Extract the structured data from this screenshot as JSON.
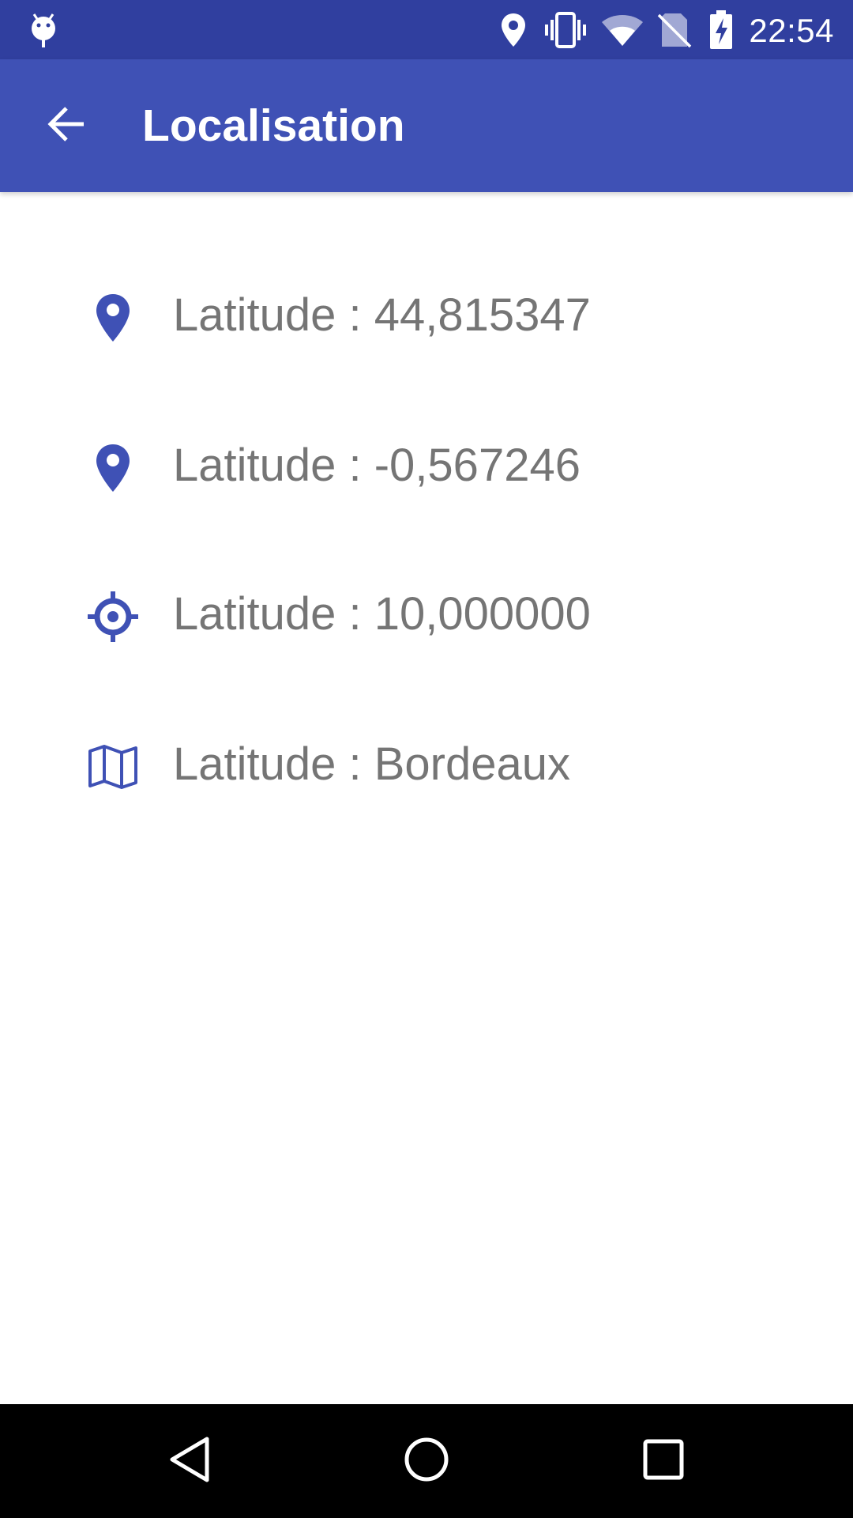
{
  "colors": {
    "status_bar": "#303f9f",
    "app_bar": "#3f51b5",
    "accent_icon": "#3f51b5",
    "text_secondary": "#757575",
    "nav_bar": "#000000"
  },
  "status_bar": {
    "time": "22:54",
    "icons": [
      "android-debug-icon",
      "location-icon",
      "vibrate-icon",
      "wifi-icon",
      "no-sim-icon",
      "battery-charging-icon"
    ]
  },
  "app_bar": {
    "title": "Localisation",
    "back_icon": "arrow-back-icon"
  },
  "rows": [
    {
      "icon": "map-pin-icon",
      "label": "Latitude : 44,815347"
    },
    {
      "icon": "map-pin-icon",
      "label": "Latitude : -0,567246"
    },
    {
      "icon": "crosshairs-gps-icon",
      "label": "Latitude : 10,000000"
    },
    {
      "icon": "map-icon",
      "label": "Latitude : Bordeaux"
    }
  ],
  "nav_bar": {
    "buttons": [
      "back-triangle-icon",
      "home-circle-icon",
      "recents-square-icon"
    ]
  }
}
